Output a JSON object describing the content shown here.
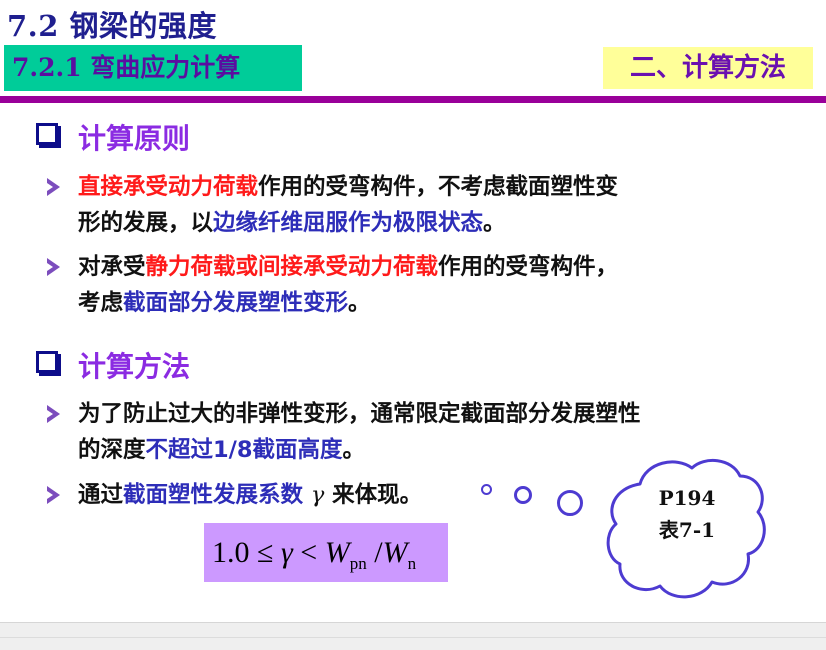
{
  "title": "7.2 钢梁的强度",
  "subtitle_left": "7.2.1  弯曲应力计算",
  "subtitle_right": "二、计算方法",
  "section1": {
    "heading": "计算原则",
    "bullet1": {
      "line1_red": "直接承受动力荷载",
      "line1_text": "作用的受弯构件，不考虑截面塑性变",
      "line2_text": "形的发展，以",
      "line2_blue": "边缘纤维屈服作为极限状态",
      "line2_end": "。"
    },
    "bullet2": {
      "line1_text": "对承受",
      "line1_red": "静力荷载或间接承受动力荷载",
      "line1_end": "作用的受弯构件，",
      "line2_text": "考虑",
      "line2_blue": "截面部分发展塑性变形",
      "line2_end": "。"
    }
  },
  "section2": {
    "heading": "计算方法",
    "bullet1": {
      "line1_text": "为了防止过大的非弹性变形，通常限定截面部分发展塑性",
      "line2_text": "的深度",
      "line2_blue": "不超过1/8截面高度",
      "line2_end": "。"
    },
    "bullet2": {
      "text": "通过",
      "blue": "截面塑性发展系数",
      "symbol": "γ",
      "end": " 来体现。"
    }
  },
  "formula": {
    "lhs": "1.0 ≤ ",
    "gamma": "γ",
    "lt": " < ",
    "w1": "W",
    "w1_sub": "pn",
    "slash": " /",
    "w2": "W",
    "w2_sub": "n"
  },
  "callout": {
    "line1": "P194",
    "line2": "表7-1"
  },
  "colors": {
    "title": "#1f1f8f",
    "subtitle_left_bg": "#00cc99",
    "subtitle_right_bg": "#ffff99",
    "rule": "#990099",
    "heading": "#8b2be2",
    "red": "#ff1a1a",
    "blue": "#2d2db8",
    "formula_bg": "#cc99ff",
    "cloud_outline": "#4d3bd1"
  }
}
